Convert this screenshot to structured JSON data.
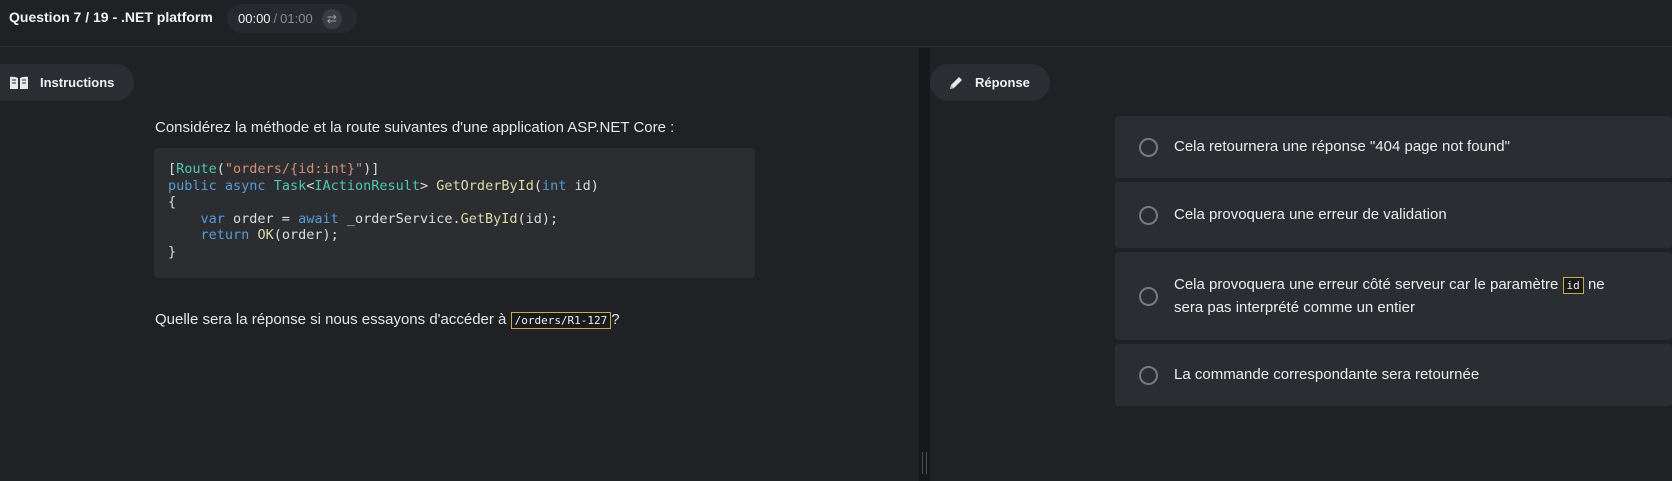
{
  "header": {
    "title": "Question 7 / 19 - .NET platform",
    "timer_elapsed": "00:00",
    "timer_sep": "/",
    "timer_total": "01:00"
  },
  "instructions": {
    "label": "Instructions",
    "intro": "Considérez la méthode et la route suivantes d'une application ASP.NET Core :",
    "code_lines": [
      "[Route(\"orders/{id:int}\")]",
      "public async Task<IActionResult> GetOrderById(int id)",
      "{",
      "    var order = await _orderService.GetById(id);",
      "    return OK(order);",
      "}"
    ],
    "question_prefix": "Quelle sera la réponse si nous essayons d'accéder à ",
    "question_code": "/orders/R1-127",
    "question_suffix": "?"
  },
  "response": {
    "label": "Réponse",
    "options": [
      {
        "text": "Cela retournera une réponse \"404 page not found\"",
        "selected": false
      },
      {
        "text": "Cela provoquera une erreur de validation",
        "selected": false
      },
      {
        "text_before": "Cela provoquera une erreur côté serveur car le paramètre ",
        "code": "id",
        "text_after": " ne sera pas interprété comme un entier",
        "selected": false
      },
      {
        "text": "La commande correspondante sera retournée",
        "selected": false
      }
    ]
  },
  "icons": {
    "instructions": "book-icon",
    "response": "pencil-icon",
    "timer_toggle": "swap-icon"
  },
  "colors": {
    "background": "#1f2125",
    "panel": "#2a2d31",
    "code_keyword": "#569cd6",
    "code_type": "#4ec9b0",
    "code_string": "#ce9178",
    "code_method": "#dcdcaa",
    "inline_code_border": "#c9a94f"
  }
}
